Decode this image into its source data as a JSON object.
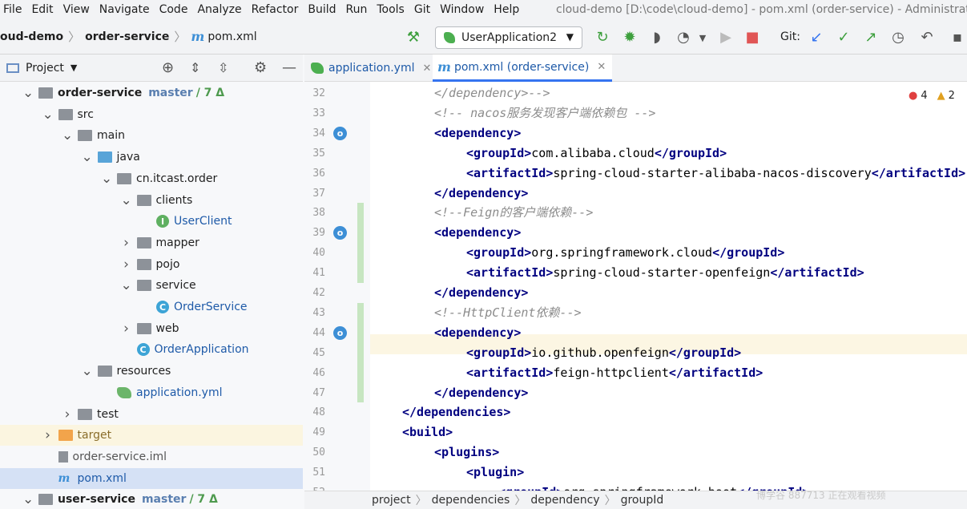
{
  "menu": [
    "File",
    "Edit",
    "View",
    "Navigate",
    "Code",
    "Analyze",
    "Refactor",
    "Build",
    "Run",
    "Tools",
    "Git",
    "Window",
    "Help"
  ],
  "window_title": "cloud-demo [D:\\code\\cloud-demo] - pom.xml (order-service) - Administrator",
  "breadcrumbs": [
    "oud-demo",
    "order-service",
    "pom.xml"
  ],
  "run_config": "UserApplication2",
  "git_label": "Git:",
  "project_label": "Project",
  "tabs": [
    {
      "label": "application.yml",
      "active": false
    },
    {
      "label": "pom.xml (order-service)",
      "active": true
    }
  ],
  "tree": [
    {
      "name": "order-service",
      "branch": "master",
      "changes": "/ 7 Δ",
      "depth": 1,
      "arrow": "v",
      "icon": "module-folder"
    },
    {
      "name": "src",
      "depth": 2,
      "arrow": "v",
      "icon": "folder"
    },
    {
      "name": "main",
      "depth": 3,
      "arrow": "v",
      "icon": "folder"
    },
    {
      "name": "java",
      "depth": 4,
      "arrow": "v",
      "icon": "folder-blue"
    },
    {
      "name": "cn.itcast.order",
      "depth": 5,
      "arrow": "v",
      "icon": "package"
    },
    {
      "name": "clients",
      "depth": 6,
      "arrow": "v",
      "icon": "package"
    },
    {
      "name": "UserClient",
      "depth": 7,
      "arrow": "",
      "icon": "interface"
    },
    {
      "name": "mapper",
      "depth": 6,
      "arrow": ">",
      "icon": "package"
    },
    {
      "name": "pojo",
      "depth": 6,
      "arrow": ">",
      "icon": "package"
    },
    {
      "name": "service",
      "depth": 6,
      "arrow": "v",
      "icon": "package"
    },
    {
      "name": "OrderService",
      "depth": 7,
      "arrow": "",
      "icon": "class"
    },
    {
      "name": "web",
      "depth": 6,
      "arrow": ">",
      "icon": "package"
    },
    {
      "name": "OrderApplication",
      "depth": 6,
      "arrow": "",
      "icon": "spring-class"
    },
    {
      "name": "resources",
      "depth": 4,
      "arrow": "v",
      "icon": "resources"
    },
    {
      "name": "application.yml",
      "depth": 5,
      "arrow": "",
      "icon": "yml"
    },
    {
      "name": "test",
      "depth": 3,
      "arrow": ">",
      "icon": "folder"
    },
    {
      "name": "target",
      "depth": 2,
      "arrow": ">",
      "icon": "folder-orange"
    },
    {
      "name": "order-service.iml",
      "depth": 2,
      "arrow": "",
      "icon": "iml"
    },
    {
      "name": "pom.xml",
      "depth": 2,
      "arrow": "",
      "icon": "maven"
    },
    {
      "name": "user-service",
      "branch": "master",
      "changes": "/ 7 Δ",
      "depth": 1,
      "arrow": "v",
      "icon": "module-folder"
    }
  ],
  "inspections": {
    "errors": "4",
    "warnings": "2"
  },
  "lines": [
    {
      "n": "32",
      "indent": 2,
      "parts": [
        [
          "cmt",
          "</dependency>-->"
        ]
      ]
    },
    {
      "n": "33",
      "indent": 2,
      "parts": [
        [
          "cmt",
          "<!-- nacos服务发现客户端依赖包 -->"
        ]
      ]
    },
    {
      "n": "34",
      "indent": 2,
      "parts": [
        [
          "tag",
          "<dependency>"
        ]
      ]
    },
    {
      "n": "35",
      "indent": 3,
      "parts": [
        [
          "tag",
          "<groupId>"
        ],
        [
          "txt",
          "com.alibaba.cloud"
        ],
        [
          "tag",
          "</groupId>"
        ]
      ]
    },
    {
      "n": "36",
      "indent": 3,
      "parts": [
        [
          "tag",
          "<artifactId>"
        ],
        [
          "txt",
          "spring-cloud-starter-alibaba-nacos-discovery"
        ],
        [
          "tag",
          "</artifactId>"
        ]
      ]
    },
    {
      "n": "37",
      "indent": 2,
      "parts": [
        [
          "tag",
          "</dependency>"
        ]
      ]
    },
    {
      "n": "38",
      "indent": 2,
      "parts": [
        [
          "cmt",
          "<!--Feign的客户端依赖-->"
        ]
      ]
    },
    {
      "n": "39",
      "indent": 2,
      "parts": [
        [
          "tag",
          "<dependency>"
        ]
      ]
    },
    {
      "n": "40",
      "indent": 3,
      "parts": [
        [
          "tag",
          "<groupId>"
        ],
        [
          "txt",
          "org.springframework.cloud"
        ],
        [
          "tag",
          "</groupId>"
        ]
      ]
    },
    {
      "n": "41",
      "indent": 3,
      "parts": [
        [
          "tag",
          "<artifactId>"
        ],
        [
          "txt",
          "spring-cloud-starter-openfeign"
        ],
        [
          "tag",
          "</artifactId>"
        ]
      ]
    },
    {
      "n": "42",
      "indent": 2,
      "parts": [
        [
          "tag",
          "</dependency>"
        ]
      ]
    },
    {
      "n": "43",
      "indent": 2,
      "parts": [
        [
          "cmt",
          "<!--HttpClient依赖-->"
        ]
      ]
    },
    {
      "n": "44",
      "indent": 2,
      "parts": [
        [
          "tag",
          "<dependency>"
        ]
      ]
    },
    {
      "n": "45",
      "indent": 3,
      "parts": [
        [
          "tag",
          "<groupId>"
        ],
        [
          "txt",
          "io.github.openfeign"
        ],
        [
          "tag",
          "</groupId>"
        ]
      ]
    },
    {
      "n": "46",
      "indent": 3,
      "parts": [
        [
          "tag",
          "<artifactId>"
        ],
        [
          "txt",
          "feign-httpclient"
        ],
        [
          "tag",
          "</artifactId>"
        ]
      ]
    },
    {
      "n": "47",
      "indent": 2,
      "parts": [
        [
          "tag",
          "</dependency>"
        ]
      ]
    },
    {
      "n": "48",
      "indent": 1,
      "parts": [
        [
          "tag",
          "</dependencies>"
        ]
      ]
    },
    {
      "n": "49",
      "indent": 1,
      "parts": [
        [
          "tag",
          "<build>"
        ]
      ]
    },
    {
      "n": "50",
      "indent": 2,
      "parts": [
        [
          "tag",
          "<plugins>"
        ]
      ]
    },
    {
      "n": "51",
      "indent": 3,
      "parts": [
        [
          "tag",
          "<plugin>"
        ]
      ]
    },
    {
      "n": "52",
      "indent": 4,
      "parts": [
        [
          "tag",
          "<groupId>"
        ],
        [
          "txt",
          "org.springframework.boot"
        ],
        [
          "tag",
          "</groupId>"
        ]
      ]
    }
  ],
  "status_path": [
    "project",
    "dependencies",
    "dependency",
    "groupId"
  ],
  "watermark": "博学谷 887713 正在观看视频"
}
